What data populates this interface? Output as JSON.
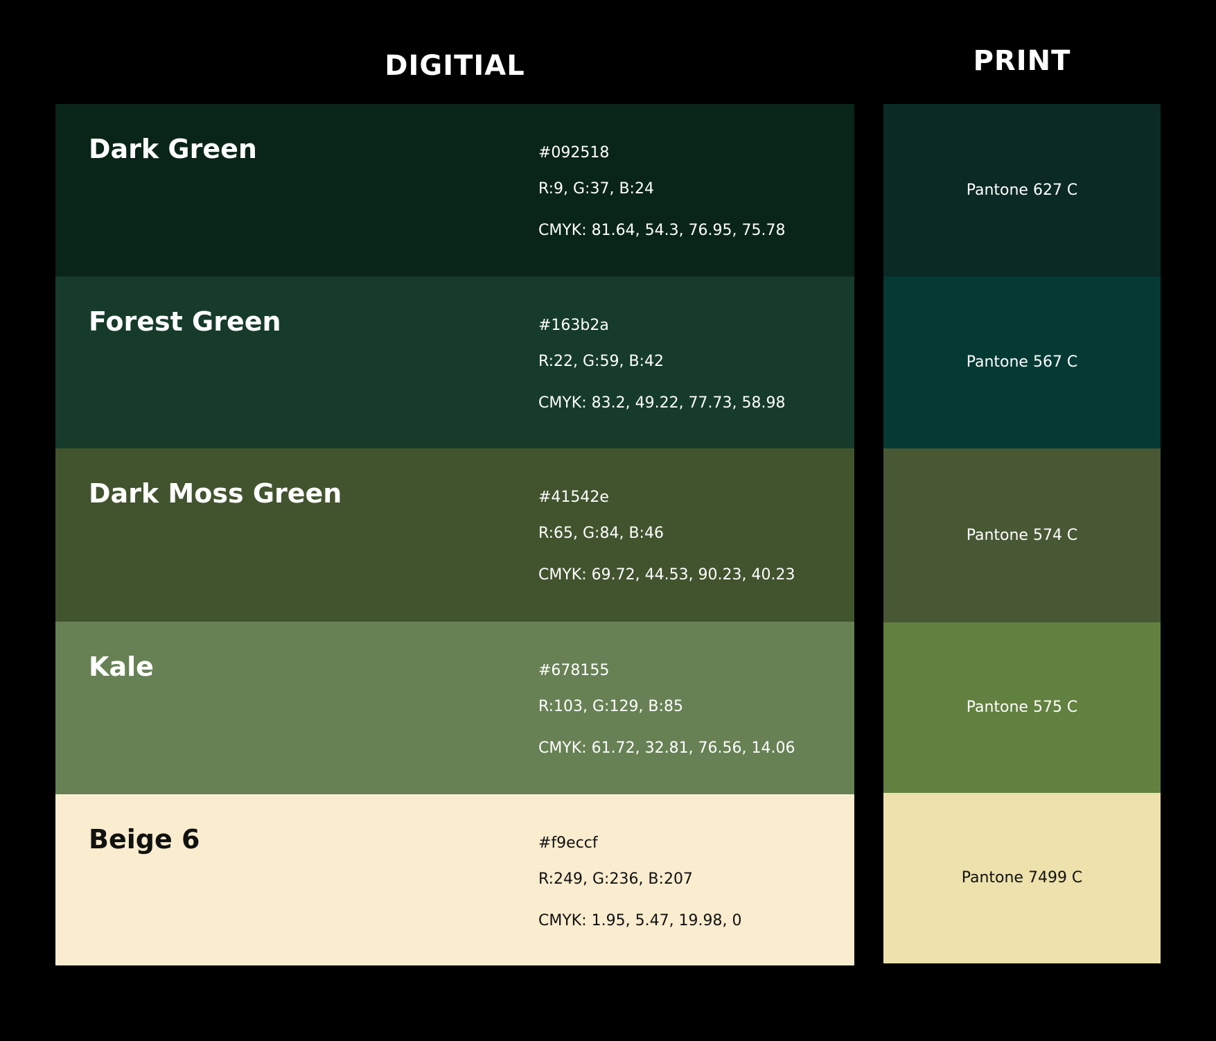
{
  "headings": {
    "digital": "DIGITIAL",
    "print": "PRINT"
  },
  "swatches": [
    {
      "name": "Dark Green",
      "hex": "#092518",
      "rgb": "R:9,  G:37, B:24",
      "cmyk": "CMYK: 81.64, 54.3, 76.95, 75.78",
      "pantone": "Pantone 627 C",
      "digital_color": "#092518",
      "print_color": "#0b2a25",
      "text_color": "#ffffff"
    },
    {
      "name": "Forest Green",
      "hex": "#163b2a",
      "rgb": "R:22,  G:59, B:42",
      "cmyk": "CMYK: 83.2, 49.22, 77.73, 58.98",
      "pantone": "Pantone 567 C",
      "digital_color": "#163b2a",
      "print_color": "#043a33",
      "text_color": "#ffffff"
    },
    {
      "name": "Dark Moss Green",
      "hex": "#41542e",
      "rgb": "R:65,  G:84, B:46",
      "cmyk": "CMYK: 69.72, 44.53, 90.23, 40.23",
      "pantone": "Pantone 574 C",
      "digital_color": "#41542e",
      "print_color": "#485734",
      "text_color": "#ffffff"
    },
    {
      "name": "Kale",
      "hex": "#678155",
      "rgb": "R:103,  G:129, B:85",
      "cmyk": "CMYK: 61.72, 32.81, 76.56, 14.06",
      "pantone": "Pantone 575 C",
      "digital_color": "#678155",
      "print_color": "#628040",
      "text_color": "#ffffff"
    },
    {
      "name": "Beige 6",
      "hex": "#f9eccf",
      "rgb": "R:249,  G:236, B:207",
      "cmyk": "CMYK: 1.95, 5.47, 19.98, 0",
      "pantone": "Pantone 7499 C",
      "digital_color": "#f9eccf",
      "print_color": "#ede1ac",
      "text_color": "#111111"
    }
  ]
}
